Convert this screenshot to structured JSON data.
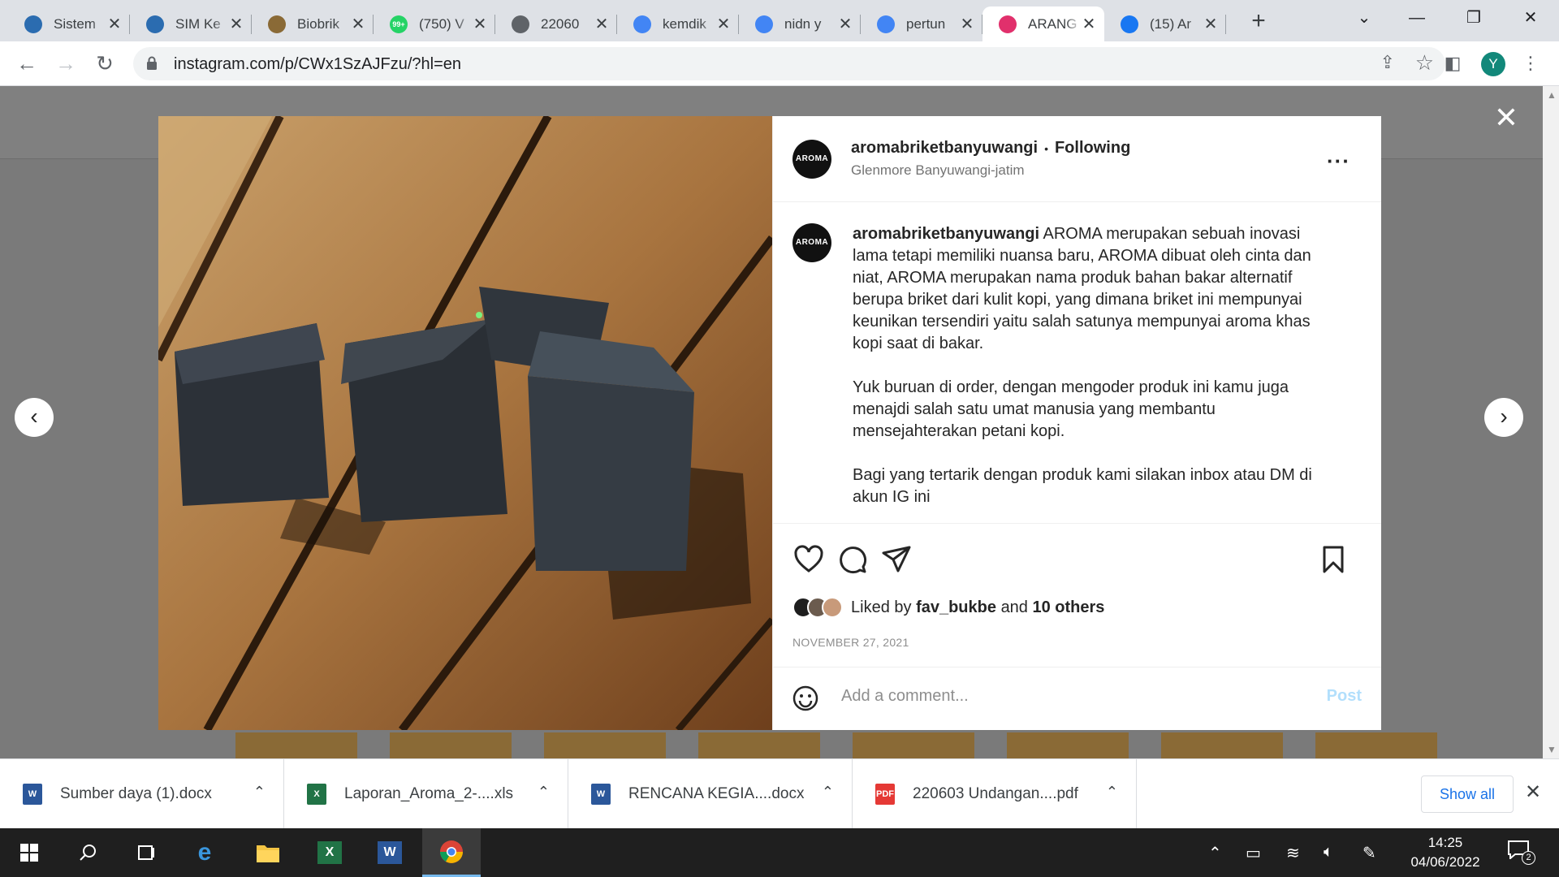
{
  "browser": {
    "tabs": [
      {
        "title": "Sistem",
        "favicon": "kemdikbud-logo",
        "color": "#2b6cb0"
      },
      {
        "title": "SIM Ke",
        "favicon": "kemdikbud-logo",
        "color": "#2b6cb0"
      },
      {
        "title": "Biobrik",
        "favicon": "image-thumb",
        "color": "#8a6a36"
      },
      {
        "title": "(750) V",
        "favicon": "whatsapp-icon",
        "color": "#25d366",
        "badge": "99+"
      },
      {
        "title": "22060",
        "favicon": "globe-icon",
        "color": "#5f6368"
      },
      {
        "title": "kemdik",
        "favicon": "google-icon",
        "color": "#4285f4"
      },
      {
        "title": "nidn y",
        "favicon": "google-icon",
        "color": "#4285f4"
      },
      {
        "title": "pertun",
        "favicon": "google-icon",
        "color": "#4285f4"
      },
      {
        "title": "ARANG",
        "favicon": "instagram-icon",
        "color": "#e1306c",
        "active": true
      },
      {
        "title": "(15) Ar",
        "favicon": "facebook-icon",
        "color": "#1877f2"
      }
    ],
    "url": "instagram.com/p/CWx1SzAJFzu/?hl=en",
    "profile_initial": "Y"
  },
  "post": {
    "username": "aromabriketbanyuwangi",
    "logo_text": "AROMA",
    "following_label": "Following",
    "location": "Glenmore Banyuwangi-jatim",
    "caption_paragraphs": [
      "AROMA merupakan sebuah inovasi lama tetapi memiliki nuansa baru, AROMA dibuat oleh cinta dan niat, AROMA merupakan nama produk bahan bakar alternatif berupa briket dari kulit kopi, yang dimana briket ini mempunyai keunikan tersendiri yaitu salah satunya mempunyai aroma khas kopi saat di bakar.",
      "Yuk buruan di order, dengan mengoder produk ini kamu juga menajdi salah satu umat manusia yang membantu mensejahterakan petani kopi.",
      "Bagi yang tertarik dengan produk kami silakan inbox atau DM di akun IG ini"
    ],
    "liked_by_prefix": "Liked by",
    "liked_by_user": "fav_bukbe",
    "liked_by_and": "and",
    "liked_by_others": "10 others",
    "date": "NOVEMBER 27, 2021",
    "comment_placeholder": "Add a comment...",
    "post_button": "Post"
  },
  "downloads": {
    "items": [
      {
        "name": "Sumber daya (1).docx",
        "type": "word",
        "color": "#2b579a",
        "label": "W"
      },
      {
        "name": "Laporan_Aroma_2-....xls",
        "type": "excel",
        "color": "#217346",
        "label": "X"
      },
      {
        "name": "RENCANA KEGIA....docx",
        "type": "word",
        "color": "#2b579a",
        "label": "W"
      },
      {
        "name": "220603 Undangan....pdf",
        "type": "pdf",
        "color": "#e53935",
        "label": "PDF"
      }
    ],
    "show_all": "Show all"
  },
  "taskbar": {
    "time": "14:25",
    "date": "04/06/2022",
    "notification_count": "2"
  },
  "colors": {
    "instagram_link_blue": "#b2dffc",
    "chrome_accent": "#1a73e8"
  }
}
